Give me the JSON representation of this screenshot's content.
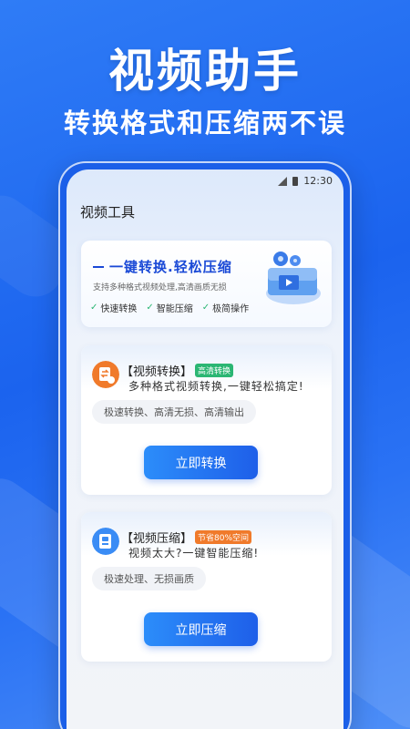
{
  "hero": {
    "title": "视频助手",
    "subtitle": "转换格式和压缩两不误"
  },
  "status_bar": {
    "time": "12:30"
  },
  "page": {
    "title": "视频工具"
  },
  "banner": {
    "headline": "一键转换.轻松压缩",
    "description": "支持多种格式视频处理,高清画质无损",
    "features": [
      "快速转换",
      "智能压缩",
      "极简操作"
    ]
  },
  "cards": [
    {
      "title": "【视频转换】",
      "tag": "高清转换",
      "tag_color": "#2bb673",
      "description": "多种格式视频转换,一键轻松搞定!",
      "chip": "极速转换、高清无损、高清输出",
      "button": "立即转换",
      "icon": "convert-icon",
      "icon_color": "#f07a2b"
    },
    {
      "title": "【视频压缩】",
      "tag": "节省80%空间",
      "tag_color": "#f07a2b",
      "description": "视频太大?一键智能压缩!",
      "chip": "极速处理、无损画质",
      "button": "立即压缩",
      "icon": "compress-icon",
      "icon_color": "#3a8cf5"
    }
  ],
  "colors": {
    "background": "#1b63ee",
    "accent": "#1e5fe9",
    "success": "#2bb673",
    "warning": "#f07a2b"
  }
}
